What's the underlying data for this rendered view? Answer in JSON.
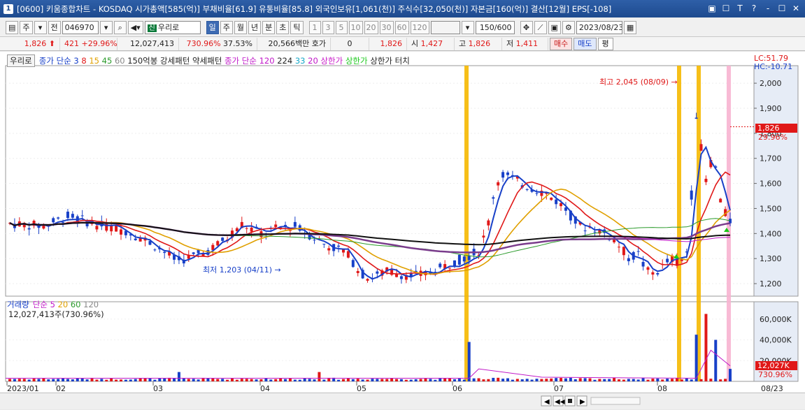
{
  "window": {
    "number": "1",
    "title": "[0600] 키움종합차트 - KOSDAQ 시가총액[585(억)] 부채비율[61.9] 유통비율[85.8] 외국인보유[1,061(천)] 주식수[32,050(천)] 자본금[160(억)] 결산[12월] EPS[-108]",
    "controls": [
      "▣",
      "☐",
      "T",
      "?",
      "-",
      "☐",
      "✕"
    ]
  },
  "toolbar": {
    "left_btns": [
      "주",
      "전"
    ],
    "code": "046970",
    "stock_tag": "신",
    "stock_name": "우리로",
    "periods": [
      "일",
      "주",
      "월",
      "년",
      "분",
      "초",
      "틱"
    ],
    "active_period": "일",
    "intervals": [
      "1",
      "3",
      "5",
      "10",
      "20",
      "30",
      "60",
      "120"
    ],
    "count": "150/600",
    "date": "2023/08/23"
  },
  "quote": {
    "price": "1,826",
    "change": "421",
    "change_pct": "+29.96%",
    "volume": "12,027,413",
    "vol_ratio": "730.96%",
    "turnover": "37.53%",
    "amount": "20,566백만",
    "hoga_label": "호가",
    "hoga_value": "0",
    "ask": "1,826",
    "open_label": "시",
    "open": "1,427",
    "high_label": "고",
    "high": "1,826",
    "low_label": "저",
    "low": "1,411",
    "buy": "매수",
    "sell": "매도",
    "eval": "평"
  },
  "legend": {
    "tag": "우리로",
    "items": [
      {
        "text": "종가 단순 3",
        "color": "#1840c8"
      },
      {
        "text": "8",
        "color": "#e01818"
      },
      {
        "text": "15",
        "color": "#e0a000"
      },
      {
        "text": "45",
        "color": "#2a9a2a"
      },
      {
        "text": "60",
        "color": "#888888"
      },
      {
        "text": "150억봉 강세패턴",
        "color": "#222222"
      },
      {
        "text": "약세패턴",
        "color": "#222222"
      },
      {
        "text": "종가 단순 120",
        "color": "#c018c8"
      },
      {
        "text": "224",
        "color": "#222222"
      },
      {
        "text": "33",
        "color": "#18a8c8"
      },
      {
        "text": "20",
        "color": "#c018c8"
      },
      {
        "text": "상한가",
        "color": "#c818c8"
      },
      {
        "text": "상한가",
        "color": "#18c818"
      },
      {
        "text": "상한가 터치",
        "color": "#222222"
      }
    ]
  },
  "lc_label": "LC:51.79",
  "hc_label": "HC:-10.71",
  "annotations": {
    "high": "최고 2,045 (08/09)",
    "low": "최저 1,203 (04/11)"
  },
  "price_axis": [
    "2,000",
    "1,900",
    "1,800",
    "1,700",
    "1,600",
    "1,500",
    "1,400",
    "1,300",
    "1,200"
  ],
  "current_price_tag": "1,826",
  "current_pct_tag": "29.96%",
  "volume_legend": {
    "title": "거래량",
    "items": [
      {
        "text": "단순 5",
        "color": "#c018c8"
      },
      {
        "text": "20",
        "color": "#e0a000"
      },
      {
        "text": "60",
        "color": "#2a9a2a"
      },
      {
        "text": "120",
        "color": "#888888"
      }
    ],
    "info": "12,027,413주(730.96%)"
  },
  "volume_axis": [
    "60,000K",
    "40,000K",
    "20,000K"
  ],
  "volume_tag": "12,027K",
  "volume_pct_tag": "730.96%",
  "x_axis": [
    "2023/01",
    "02",
    "03",
    "04",
    "05",
    "06",
    "07",
    "08"
  ],
  "x_end_label": "08/23",
  "chart_data": {
    "type": "candlestick",
    "price_range": [
      1150,
      2070
    ],
    "marks": {
      "high": {
        "value": 2045,
        "date": "08/09"
      },
      "low": {
        "value": 1203,
        "date": "04/11"
      }
    },
    "limit_up_days": [
      "06/07",
      "08/07",
      "08/10",
      "08/23"
    ],
    "last_close": 1826,
    "last_volume": 12027413
  }
}
